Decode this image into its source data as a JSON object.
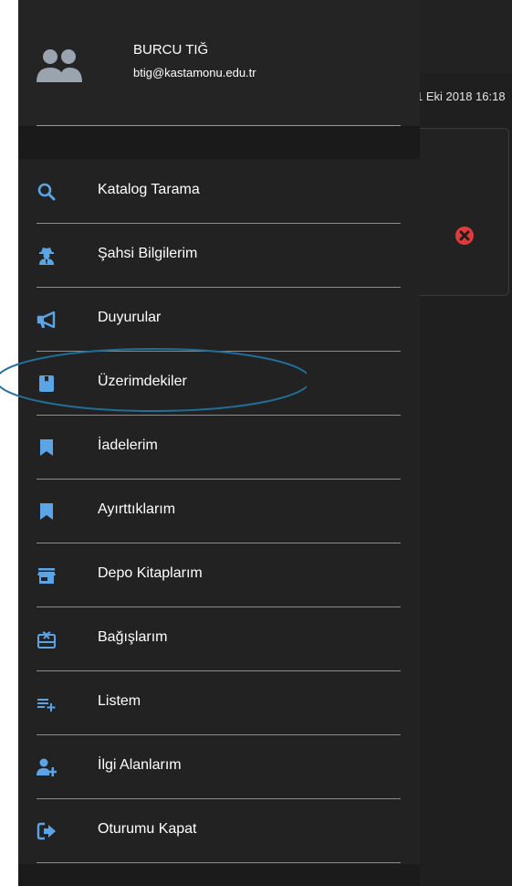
{
  "background": {
    "date_text": "1 Eki 2018 16:18",
    "close_icon": "close-circle-icon"
  },
  "user": {
    "name": "BURCU TIĞ",
    "email": "btig@kastamonu.edu.tr",
    "avatar_icon": "users-icon"
  },
  "menu": {
    "items": [
      {
        "label": "Katalog Tarama",
        "icon": "search-icon"
      },
      {
        "label": "Şahsi Bilgilerim",
        "icon": "user-secret-icon"
      },
      {
        "label": "Duyurular",
        "icon": "megaphone-icon"
      },
      {
        "label": "Üzerimdekiler",
        "icon": "book-icon"
      },
      {
        "label": "İadelerim",
        "icon": "bookmark-icon"
      },
      {
        "label": "Ayırttıklarım",
        "icon": "bookmark-icon"
      },
      {
        "label": "Depo Kitaplarım",
        "icon": "store-icon"
      },
      {
        "label": "Bağışlarım",
        "icon": "gift-card-icon"
      },
      {
        "label": "Listem",
        "icon": "playlist-add-icon"
      },
      {
        "label": "İlgi Alanlarım",
        "icon": "user-add-icon"
      },
      {
        "label": "Oturumu Kapat",
        "icon": "sign-out-icon"
      }
    ]
  },
  "colors": {
    "accent": "#5ba4e6",
    "highlight_ring": "#1f6f99",
    "close_red": "#e03a3a"
  }
}
